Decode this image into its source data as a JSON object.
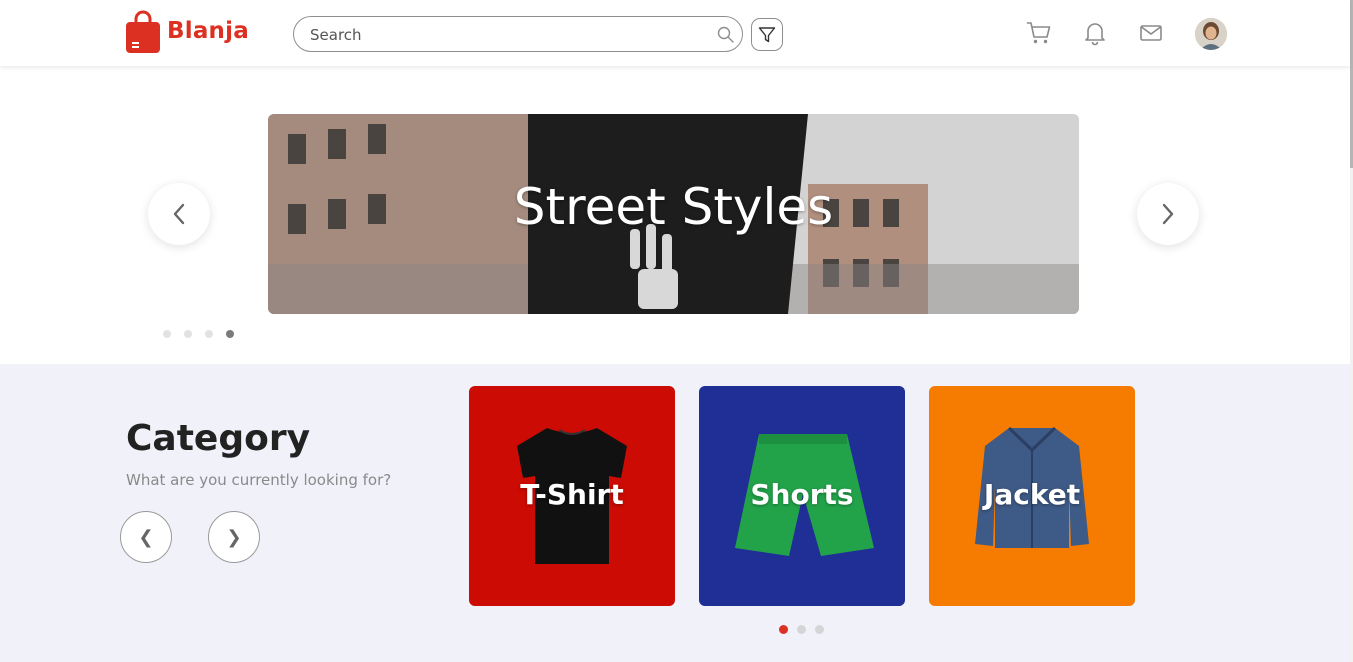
{
  "header": {
    "logo_text": "Blanja",
    "search_placeholder": "Search",
    "icons": [
      "search-icon",
      "filter-icon",
      "cart-icon",
      "bell-icon",
      "mail-icon"
    ]
  },
  "hero": {
    "caption": "Street Styles",
    "slide_count": 4,
    "active_slide": 4
  },
  "category": {
    "title": "Category",
    "subtitle": "What are you currently looking for?",
    "prev_label": "❮",
    "next_label": "❯",
    "cards": [
      {
        "label": "T-Shirt",
        "color": "#cc0b04"
      },
      {
        "label": "Shorts",
        "color": "#1f2f96"
      },
      {
        "label": "Jacket",
        "color": "#f57c00"
      }
    ],
    "page_count": 3,
    "active_page": 1
  },
  "colors": {
    "brand": "#DB3022",
    "section_bg": "#f0f1f9"
  }
}
